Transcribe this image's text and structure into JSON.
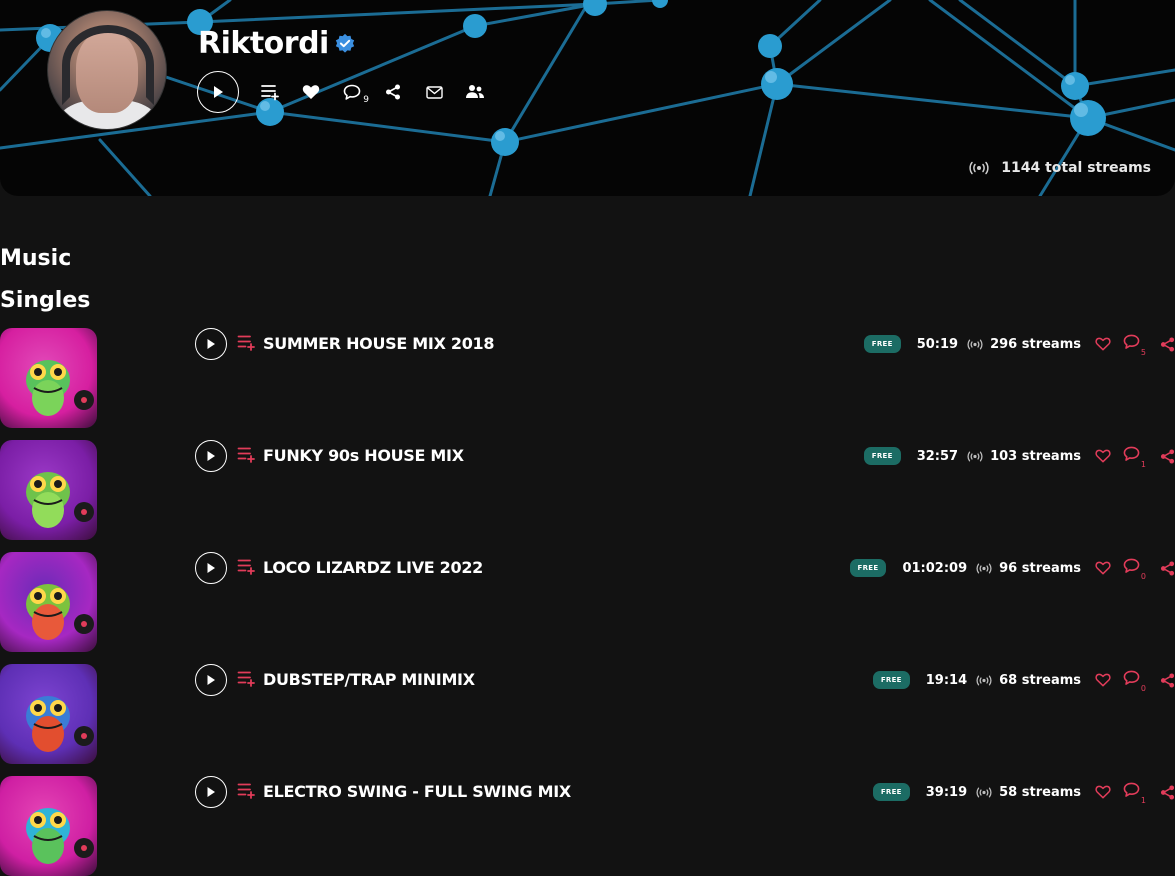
{
  "artist": {
    "name": "Riktordi",
    "comments_count": "9",
    "total_streams": "1144 total streams"
  },
  "sections": {
    "music": "Music",
    "singles": "Singles"
  },
  "tracks": [
    {
      "title": "SUMMER HOUSE MIX 2018",
      "badge": "FREE",
      "duration": "50:19",
      "streams": "296 streams",
      "comments": "5"
    },
    {
      "title": "FUNKY 90s HOUSE MIX",
      "badge": "FREE",
      "duration": "32:57",
      "streams": "103 streams",
      "comments": "1"
    },
    {
      "title": "LOCO LIZARDZ LIVE 2022",
      "badge": "FREE",
      "duration": "01:02:09",
      "streams": "96 streams",
      "comments": "0"
    },
    {
      "title": "DUBSTEP/TRAP MINIMIX",
      "badge": "FREE",
      "duration": "19:14",
      "streams": "68 streams",
      "comments": "0"
    },
    {
      "title": "ELECTRO SWING - FULL SWING MIX",
      "badge": "FREE",
      "duration": "39:19",
      "streams": "58 streams",
      "comments": "1"
    }
  ],
  "colors": {
    "background": "#121212",
    "header_bg": "#050505",
    "accent_red": "#e23c5a",
    "badge_teal": "#1c6c64",
    "network_blue": "#2f9fd6",
    "verified_blue": "#3b8fe0"
  }
}
